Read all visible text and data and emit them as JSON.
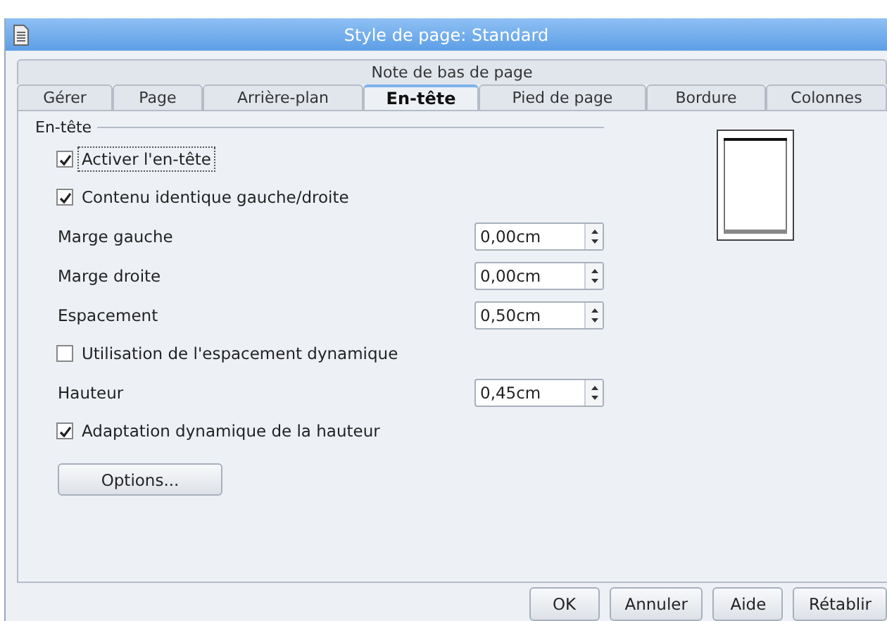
{
  "window": {
    "title": "Style de page: Standard"
  },
  "tab_rows": [
    [
      {
        "label": "Note de bas de page",
        "selected": false
      }
    ],
    [
      {
        "label": "Gérer",
        "selected": false
      },
      {
        "label": "Page",
        "selected": false
      },
      {
        "label": "Arrière-plan",
        "selected": false
      },
      {
        "label": "En-tête",
        "selected": true
      },
      {
        "label": "Pied de page",
        "selected": false
      },
      {
        "label": "Bordure",
        "selected": false
      },
      {
        "label": "Colonnes",
        "selected": false
      }
    ]
  ],
  "group": {
    "title": "En-tête",
    "items": [
      {
        "kind": "checkbox",
        "label": "Activer l'en-tête",
        "checked": true,
        "focused": true
      },
      {
        "kind": "checkbox",
        "label": "Contenu identique gauche/droite",
        "checked": true,
        "focused": false
      },
      {
        "kind": "spin",
        "label": "Marge gauche",
        "value": "0,00cm"
      },
      {
        "kind": "spin",
        "label": "Marge droite",
        "value": "0,00cm"
      },
      {
        "kind": "spin",
        "label": "Espacement",
        "value": "0,50cm"
      },
      {
        "kind": "checkbox",
        "label": "Utilisation de l'espacement dynamique",
        "checked": false,
        "focused": false
      },
      {
        "kind": "spin",
        "label": "Hauteur",
        "value": "0,45cm"
      },
      {
        "kind": "checkbox",
        "label": "Adaptation dynamique de la hauteur",
        "checked": true,
        "focused": false
      },
      {
        "kind": "button",
        "label": "Options..."
      }
    ]
  },
  "buttons": [
    "OK",
    "Annuler",
    "Aide",
    "Rétablir"
  ]
}
